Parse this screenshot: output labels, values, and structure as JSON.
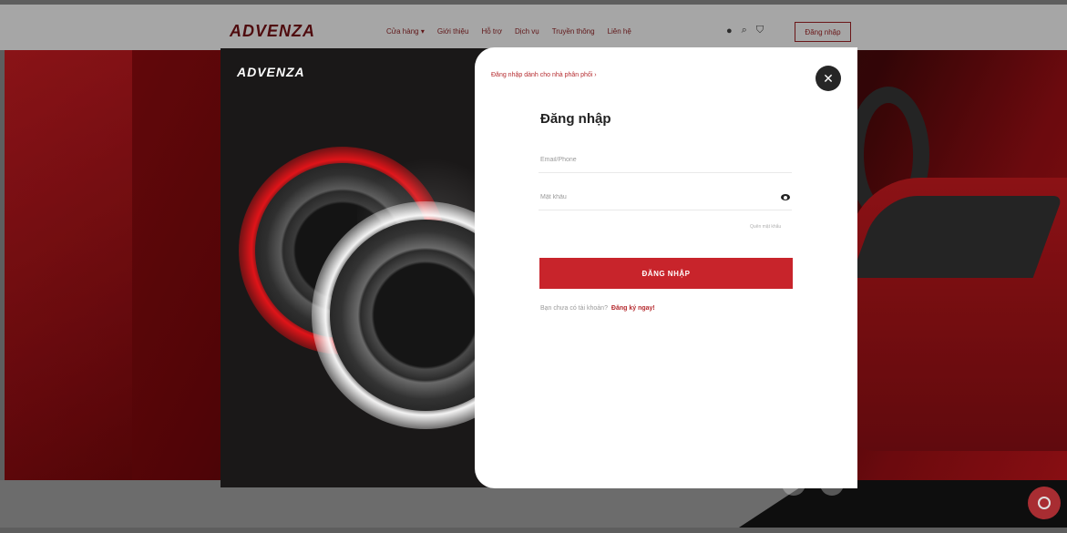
{
  "nav": {
    "logo": "ADVENZA",
    "menu": [
      "Cửa hàng ▾",
      "Giới thiệu",
      "Hỗ trợ",
      "Dịch vụ",
      "Truyền thông",
      "Liên hệ"
    ],
    "login_label": "Đăng nhập"
  },
  "modal": {
    "logo": "ADVENZA",
    "distributor_link": "Đăng nhập dành cho nhà phân phối ›",
    "title": "Đăng nhập",
    "email_placeholder": "Email/Phone",
    "password_placeholder": "Mật khẩu",
    "forgot_label": "Quên mật khẩu",
    "submit_label": "ĐĂNG NHẬP",
    "signup_prompt": "Bạn chưa có tài khoản?",
    "signup_link": "Đăng ký ngay!"
  },
  "icons": [
    "globe-icon",
    "search-icon",
    "bag-icon",
    "close-icon",
    "eye-icon",
    "chat-icon"
  ],
  "colors": {
    "brand_red": "#c8242b",
    "modal_dark": "#1a1818",
    "text_dark": "#222222"
  }
}
